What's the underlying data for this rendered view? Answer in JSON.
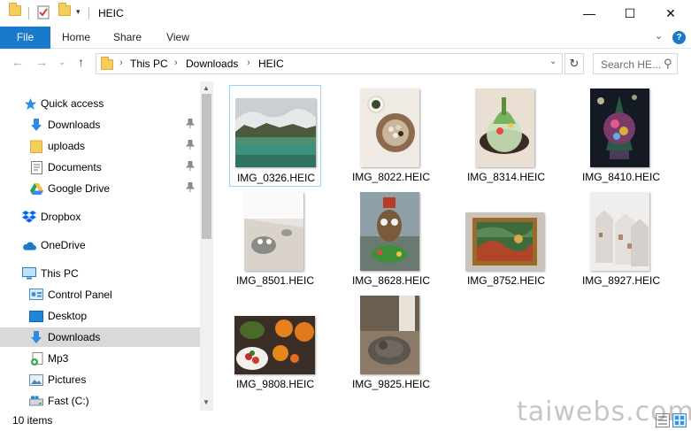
{
  "window": {
    "title": "HEIC",
    "minimize": "—",
    "maximize": "☐",
    "close": "✕"
  },
  "ribbon": {
    "tabs": [
      "File",
      "Home",
      "Share",
      "View"
    ],
    "collapse": "⌄",
    "help": "?"
  },
  "nav": {
    "back": "←",
    "forward": "→",
    "recent": "⌄",
    "up": "↑",
    "breadcrumb": [
      "This PC",
      "Downloads",
      "HEIC"
    ],
    "crumb_sep": "›",
    "dropdown": "⌄",
    "refresh": "↻",
    "search_placeholder": "Search HE...",
    "search_icon": "⚲"
  },
  "sidebar": {
    "items": [
      {
        "label": "Quick access",
        "icon": "star-icon",
        "pinned": false
      },
      {
        "label": "Downloads",
        "icon": "download-arrow-icon",
        "pinned": true
      },
      {
        "label": "uploads",
        "icon": "folder-icon",
        "pinned": true
      },
      {
        "label": "Documents",
        "icon": "document-icon",
        "pinned": true
      },
      {
        "label": "Google Drive",
        "icon": "google-drive-icon",
        "pinned": true
      },
      {
        "label": "Dropbox",
        "icon": "dropbox-icon",
        "pinned": false
      },
      {
        "label": "OneDrive",
        "icon": "cloud-icon",
        "pinned": false
      },
      {
        "label": "This PC",
        "icon": "monitor-icon",
        "pinned": false
      },
      {
        "label": "Control Panel",
        "icon": "control-panel-icon",
        "pinned": false
      },
      {
        "label": "Desktop",
        "icon": "desktop-icon",
        "pinned": false
      },
      {
        "label": "Downloads",
        "icon": "download-arrow-icon",
        "pinned": false,
        "selected": true
      },
      {
        "label": "Mp3",
        "icon": "music-icon",
        "pinned": false
      },
      {
        "label": "Pictures",
        "icon": "pictures-icon",
        "pinned": false
      },
      {
        "label": "Fast (C:)",
        "icon": "drive-icon",
        "pinned": false
      }
    ],
    "pin_glyph": "📌",
    "scroll_up": "▲",
    "scroll_down": "▼"
  },
  "files": [
    {
      "name": "IMG_0326.HEIC",
      "selected": true
    },
    {
      "name": "IMG_8022.HEIC"
    },
    {
      "name": "IMG_8314.HEIC"
    },
    {
      "name": "IMG_8410.HEIC"
    },
    {
      "name": "IMG_8501.HEIC"
    },
    {
      "name": "IMG_8628.HEIC"
    },
    {
      "name": "IMG_8752.HEIC"
    },
    {
      "name": "IMG_8927.HEIC"
    },
    {
      "name": "IMG_9808.HEIC"
    },
    {
      "name": "IMG_9825.HEIC"
    }
  ],
  "status": {
    "item_count": "10 items"
  },
  "watermark": "taiwebs.com",
  "colors": {
    "accent": "#1979ca",
    "selection": "#d9d9d9",
    "folder": "#f4cd5a"
  }
}
